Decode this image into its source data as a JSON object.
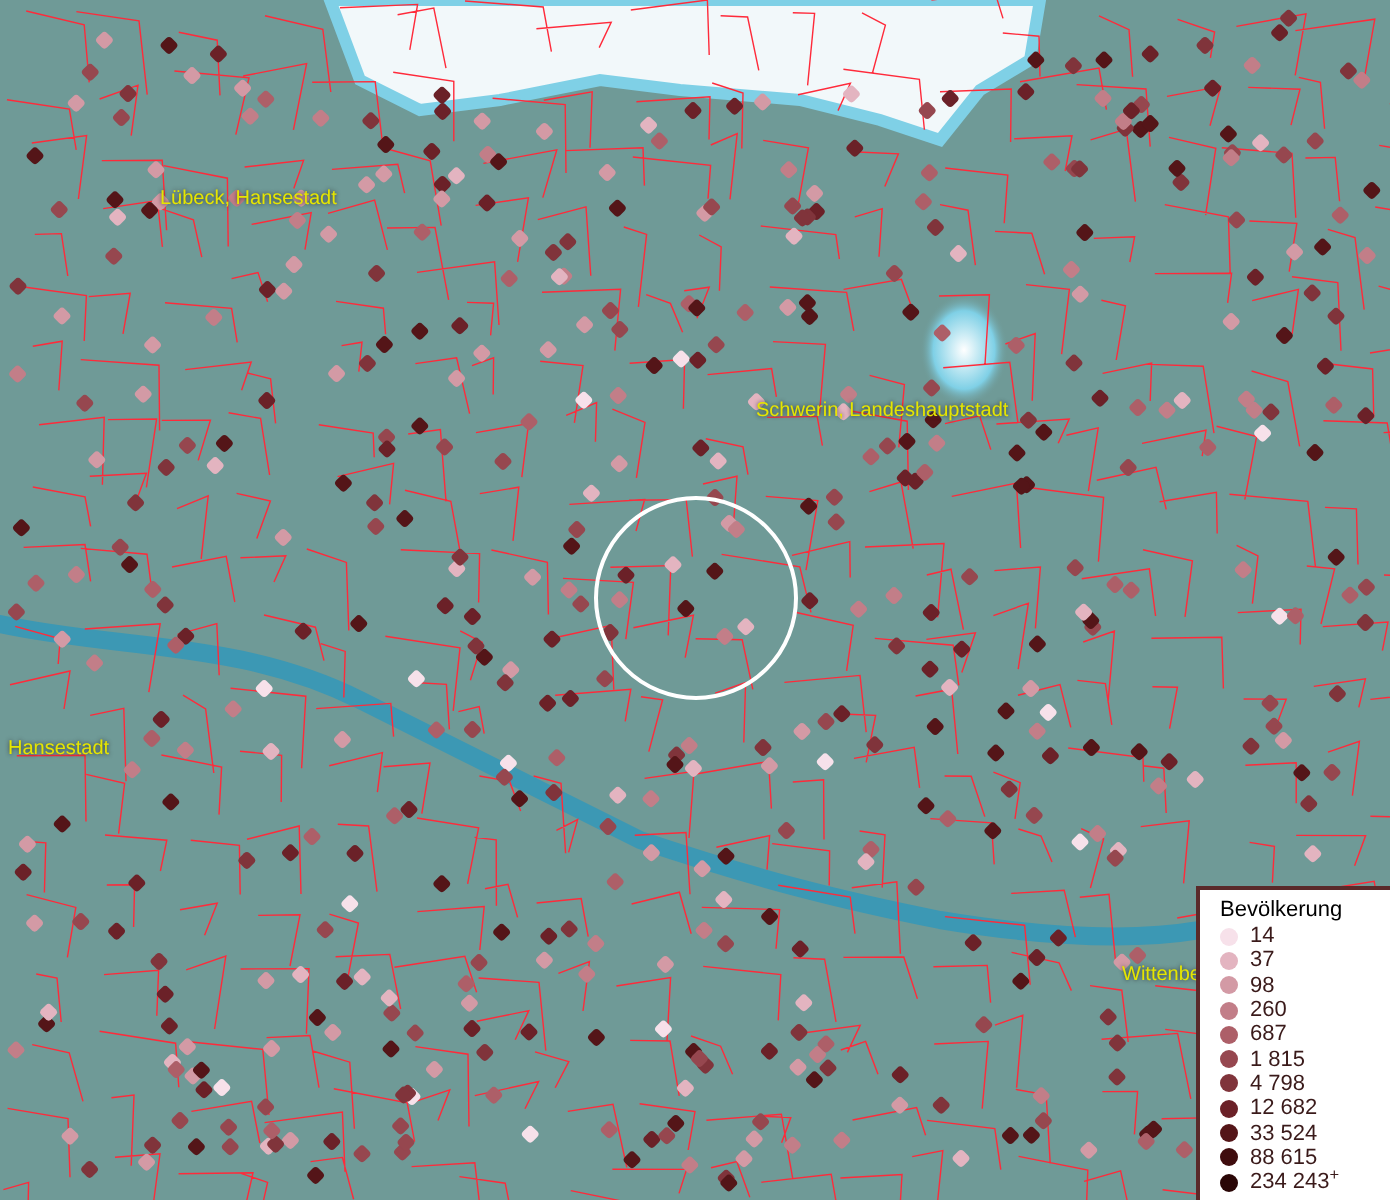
{
  "map_labels": [
    {
      "text": "Lübeck, Hansestadt"
    },
    {
      "text": "Schwerin, Landeshauptstadt"
    },
    {
      "text": "Hansestadt"
    },
    {
      "text": "Wittenbe"
    }
  ],
  "legend": {
    "title": "Bevölkerung",
    "items": [
      {
        "label": "14",
        "color": "#f7e1ea"
      },
      {
        "label": "37",
        "color": "#e3b4c0"
      },
      {
        "label": "98",
        "color": "#d39aa5"
      },
      {
        "label": "260",
        "color": "#c27e88"
      },
      {
        "label": "687",
        "color": "#ad5f68"
      },
      {
        "label": "1 815",
        "color": "#96474f"
      },
      {
        "label": "4 798",
        "color": "#80343b"
      },
      {
        "label": "12 682",
        "color": "#6b2128"
      },
      {
        "label": "33 524",
        "color": "#541518"
      },
      {
        "label": "88 615",
        "color": "#3f0c0e"
      },
      {
        "label": "234 243$^{+}$",
        "color": "#2a0606"
      }
    ]
  }
}
